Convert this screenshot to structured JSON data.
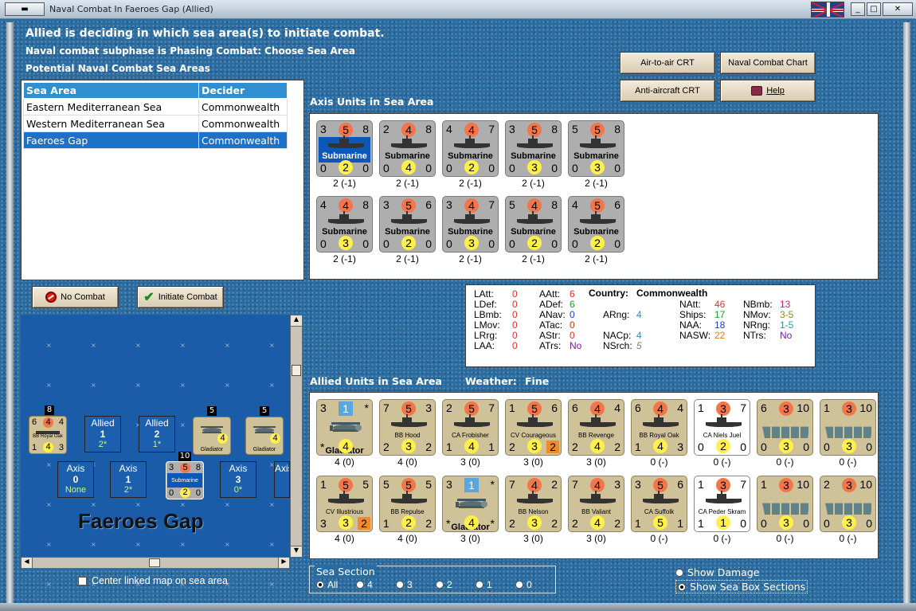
{
  "window": {
    "title": "Naval Combat In Faeroes Gap (Allied)"
  },
  "header": {
    "line1": "Allied is deciding in which sea area(s) to initiate combat.",
    "line2": "Naval combat subphase is Phasing Combat: Choose Sea Area",
    "line3": "Potential Naval Combat Sea Areas"
  },
  "buttons": {
    "air_to_air": "Air-to-air CRT",
    "naval_chart": "Naval Combat Chart",
    "anti_aircraft": "Anti-aircraft CRT",
    "help": "Help",
    "no_combat": "No Combat",
    "initiate": "Initiate Combat"
  },
  "sea_table": {
    "headers": [
      "Sea Area",
      "Decider"
    ],
    "rows": [
      {
        "area": "Eastern Mediterranean Sea",
        "decider": "Commonwealth"
      },
      {
        "area": "Western Mediterranean Sea",
        "decider": "Commonwealth"
      },
      {
        "area": "Faeroes Gap",
        "decider": "Commonwealth"
      }
    ]
  },
  "axis_label": "Axis Units in Sea Area",
  "axis_units": [
    {
      "tl": "3",
      "tc": "5",
      "tr": "8",
      "name": "Submarine",
      "bl": "0",
      "bc": "2",
      "br": "0",
      "cap": "2 (-1)"
    },
    {
      "tl": "2",
      "tc": "4",
      "tr": "8",
      "name": "Submarine",
      "bl": "0",
      "bc": "4",
      "br": "0",
      "cap": "2 (-1)"
    },
    {
      "tl": "4",
      "tc": "4",
      "tr": "7",
      "name": "Submarine",
      "bl": "0",
      "bc": "2",
      "br": "0",
      "cap": "2 (-1)"
    },
    {
      "tl": "3",
      "tc": "5",
      "tr": "8",
      "name": "Submarine",
      "bl": "0",
      "bc": "3",
      "br": "0",
      "cap": "2 (-1)"
    },
    {
      "tl": "5",
      "tc": "5",
      "tr": "8",
      "name": "Submarine",
      "bl": "0",
      "bc": "3",
      "br": "0",
      "cap": "2 (-1)"
    },
    {
      "tl": "4",
      "tc": "4",
      "tr": "8",
      "name": "Submarine",
      "bl": "0",
      "bc": "3",
      "br": "0",
      "cap": "2 (-1)"
    },
    {
      "tl": "3",
      "tc": "5",
      "tr": "6",
      "name": "Submarine",
      "bl": "0",
      "bc": "2",
      "br": "0",
      "cap": "2 (-1)"
    },
    {
      "tl": "3",
      "tc": "4",
      "tr": "7",
      "name": "Submarine",
      "bl": "0",
      "bc": "3",
      "br": "0",
      "cap": "2 (-1)"
    },
    {
      "tl": "5",
      "tc": "4",
      "tr": "8",
      "name": "Submarine",
      "bl": "0",
      "bc": "2",
      "br": "0",
      "cap": "2 (-1)"
    },
    {
      "tl": "4",
      "tc": "5",
      "tr": "6",
      "name": "Submarine",
      "bl": "0",
      "bc": "2",
      "br": "0",
      "cap": "2 (-1)"
    }
  ],
  "stats": {
    "country_label": "Country:",
    "country": "Commonwealth",
    "items": [
      {
        "k": "LAtt:",
        "v": "0"
      },
      {
        "k": "LDef:",
        "v": "0"
      },
      {
        "k": "LBmb:",
        "v": "0"
      },
      {
        "k": "LMov:",
        "v": "0"
      },
      {
        "k": "LRrg:",
        "v": "0"
      },
      {
        "k": "LAA:",
        "v": "0"
      },
      {
        "k": "AAtt:",
        "v": "6"
      },
      {
        "k": "ADef:",
        "v": "6"
      },
      {
        "k": "ANav:",
        "v": "0"
      },
      {
        "k": "ATac:",
        "v": "0"
      },
      {
        "k": "AStr:",
        "v": "0"
      },
      {
        "k": "ATrs:",
        "v": "No"
      },
      {
        "k": "ARng:",
        "v": "4"
      },
      {
        "k": "NACp:",
        "v": "4"
      },
      {
        "k": "NSrch:",
        "v": "5"
      },
      {
        "k": "NAtt:",
        "v": "46"
      },
      {
        "k": "Ships:",
        "v": "17"
      },
      {
        "k": "NAA:",
        "v": "18"
      },
      {
        "k": "NASW:",
        "v": "22"
      },
      {
        "k": "NBmb:",
        "v": "13"
      },
      {
        "k": "NMov:",
        "v": "3-5"
      },
      {
        "k": "NRng:",
        "v": "1-5"
      },
      {
        "k": "NTrs:",
        "v": "No"
      }
    ]
  },
  "allied_label": "Allied Units in Sea Area",
  "weather_label": "Weather:",
  "weather": "Fine",
  "allied_units": [
    {
      "tl": "3",
      "tc": "1",
      "tr": "*",
      "name": "Gladiator",
      "bl": "*",
      "bc": "4",
      "br": "",
      "cap": "4 (0)",
      "plane": true
    },
    {
      "tl": "7",
      "tc": "5",
      "tr": "3",
      "name": "BB Hood",
      "bl": "2",
      "bc": "3",
      "br": "2",
      "cap": "4 (0)"
    },
    {
      "tl": "2",
      "tc": "5",
      "tr": "7",
      "name": "CA Frobisher",
      "bl": "1",
      "bc": "4",
      "br": "1",
      "cap": "3 (0)"
    },
    {
      "tl": "1",
      "tc": "5",
      "tr": "6",
      "name": "CV Courageous",
      "bl": "2",
      "bc": "3",
      "br": "2",
      "cap": "3 (0)"
    },
    {
      "tl": "6",
      "tc": "4",
      "tr": "4",
      "name": "BB Revenge",
      "bl": "2",
      "bc": "4",
      "br": "2",
      "cap": "3 (0)"
    },
    {
      "tl": "6",
      "tc": "4",
      "tr": "4",
      "name": "BB Royal Oak",
      "bl": "1",
      "bc": "4",
      "br": "3",
      "cap": "0 (-)"
    },
    {
      "tl": "1",
      "tc": "3",
      "tr": "7",
      "name": "CA Niels Juel",
      "bl": "0",
      "bc": "2",
      "br": "0",
      "cap": "0 (-)"
    },
    {
      "tl": "6",
      "tc": "3",
      "tr": "10",
      "name": "",
      "bl": "0",
      "bc": "3",
      "br": "0",
      "cap": "0 (-)"
    },
    {
      "tl": "1",
      "tc": "3",
      "tr": "10",
      "name": "",
      "bl": "0",
      "bc": "3",
      "br": "0",
      "cap": "0 (-)"
    },
    {
      "tl": "1",
      "tc": "5",
      "tr": "5",
      "name": "CV Illustrious",
      "bl": "3",
      "bc": "3",
      "br": "2",
      "cap": "4 (0)"
    },
    {
      "tl": "5",
      "tc": "5",
      "tr": "5",
      "name": "BB Repulse",
      "bl": "1",
      "bc": "2",
      "br": "2",
      "cap": "4 (0)"
    },
    {
      "tl": "3",
      "tc": "1",
      "tr": "*",
      "name": "Gladiator",
      "bl": "*",
      "bc": "4",
      "br": "*",
      "cap": "3 (0)",
      "plane": true
    },
    {
      "tl": "7",
      "tc": "4",
      "tr": "2",
      "name": "BB Nelson",
      "bl": "2",
      "bc": "3",
      "br": "2",
      "cap": "3 (0)"
    },
    {
      "tl": "7",
      "tc": "4",
      "tr": "3",
      "name": "BB Valiant",
      "bl": "2",
      "bc": "4",
      "br": "2",
      "cap": "3 (0)"
    },
    {
      "tl": "3",
      "tc": "5",
      "tr": "6",
      "name": "CA Suffolk",
      "bl": "1",
      "bc": "5",
      "br": "1",
      "cap": "0 (-)"
    },
    {
      "tl": "1",
      "tc": "3",
      "tr": "7",
      "name": "CA Peder Skram",
      "bl": "1",
      "bc": "1",
      "br": "0",
      "cap": "0 (-)"
    },
    {
      "tl": "1",
      "tc": "3",
      "tr": "10",
      "name": "",
      "bl": "0",
      "bc": "3",
      "br": "0",
      "cap": "0 (-)"
    },
    {
      "tl": "2",
      "tc": "3",
      "tr": "10",
      "name": "",
      "bl": "0",
      "bc": "3",
      "br": "0",
      "cap": "0 (-)"
    }
  ],
  "minimap": {
    "title": "Faeroes Gap",
    "top_tokens": [
      {
        "l1": "Allied",
        "l2": "1",
        "l3": "2*"
      },
      {
        "l1": "Allied",
        "l2": "2",
        "l3": "1*"
      }
    ],
    "bottom_tokens": [
      {
        "l1": "Axis",
        "l2": "0",
        "l3": "None"
      },
      {
        "l1": "Axis",
        "l2": "1",
        "l3": "2*"
      },
      {
        "l1": "Axis",
        "l2": "3",
        "l3": "0*"
      },
      {
        "l1": "Axis",
        "l2": "",
        "l3": ""
      }
    ],
    "royal_oak": {
      "tl": "6",
      "tc": "4",
      "tr": "4",
      "name": "BB Royal Oak",
      "bl": "1",
      "bc": "4",
      "br": "3",
      "stack": "8"
    },
    "glad1": {
      "stack": "5",
      "name": "Gladiator",
      "bc": "4"
    },
    "glad2": {
      "stack": "5",
      "name": "Gladiator",
      "bc": "4"
    },
    "sub": {
      "stack": "10",
      "tl": "3",
      "tc": "5",
      "tr": "8",
      "name": "Submarine",
      "bl": "0",
      "bc": "2",
      "br": "0"
    }
  },
  "center_link": "Center linked map on sea area",
  "sea_section": {
    "label": "Sea Section",
    "options": [
      "All",
      "4",
      "3",
      "2",
      "1",
      "0"
    ],
    "selected": "All"
  },
  "toggles": {
    "damage": "Show Damage",
    "sections": "Show Sea Box Sections"
  }
}
